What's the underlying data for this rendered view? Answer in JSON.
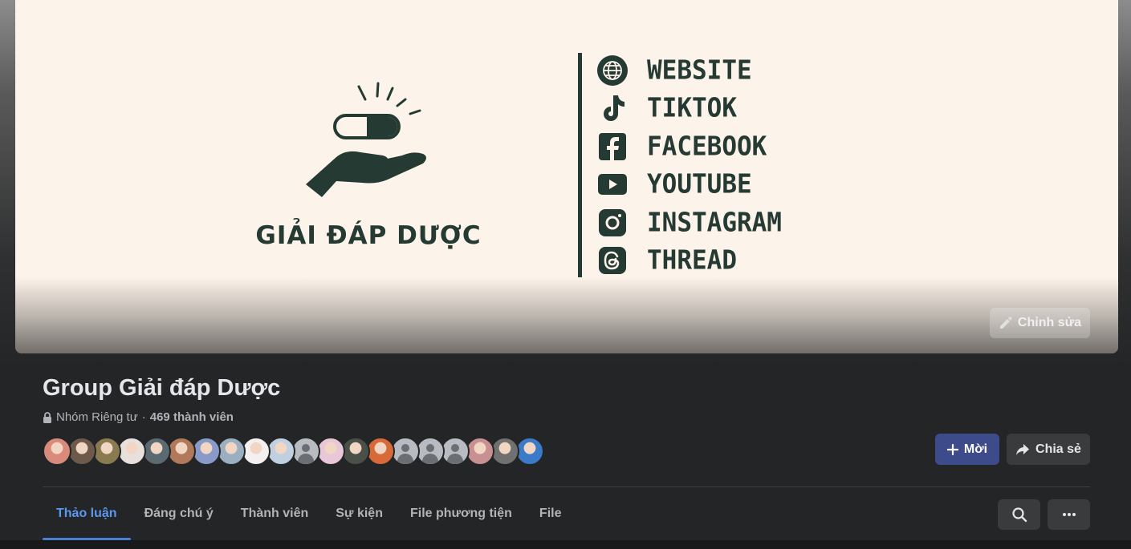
{
  "cover": {
    "brand_name": "GIẢI ĐÁP DƯỢC",
    "social_links": [
      {
        "label": "WEBSITE",
        "icon": "globe-icon"
      },
      {
        "label": "TIKTOK",
        "icon": "tiktok-icon"
      },
      {
        "label": "FACEBOOK",
        "icon": "facebook-icon"
      },
      {
        "label": "YOUTUBE",
        "icon": "youtube-icon"
      },
      {
        "label": "INSTAGRAM",
        "icon": "instagram-icon"
      },
      {
        "label": "THREAD",
        "icon": "threads-icon"
      }
    ],
    "edit_label": "Chỉnh sửa",
    "brand_color": "#243a33",
    "background_color": "#fcf3ea"
  },
  "group": {
    "title": "Group Giải đáp Dược",
    "privacy": "Nhóm Riêng tư",
    "separator": "·",
    "member_count": "469 thành viên"
  },
  "members": [
    {
      "color": "#d98a7a"
    },
    {
      "color": "#6e5a4a"
    },
    {
      "color": "#8a7a50"
    },
    {
      "color": "#e8e0dc"
    },
    {
      "color": "#5a6a70"
    },
    {
      "color": "#b07a5a"
    },
    {
      "color": "#8a9ac8"
    },
    {
      "color": "#9ab0c0"
    },
    {
      "color": "#f4f0f0"
    },
    {
      "color": "#c0d0e0"
    },
    {
      "color": "blank"
    },
    {
      "color": "#e8c8d8"
    },
    {
      "color": "#4a5048"
    },
    {
      "color": "#d86a3a"
    },
    {
      "color": "blank"
    },
    {
      "color": "blank"
    },
    {
      "color": "blank"
    },
    {
      "color": "#c89090"
    },
    {
      "color": "#707070"
    },
    {
      "color": "#3a7ac8"
    }
  ],
  "actions": {
    "invite_label": "Mời",
    "share_label": "Chia sẻ"
  },
  "tabs": [
    {
      "label": "Thảo luận",
      "active": true
    },
    {
      "label": "Đáng chú ý",
      "active": false
    },
    {
      "label": "Thành viên",
      "active": false
    },
    {
      "label": "Sự kiện",
      "active": false
    },
    {
      "label": "File phương tiện",
      "active": false
    },
    {
      "label": "File",
      "active": false
    }
  ],
  "accent_color": "#5b97f0"
}
